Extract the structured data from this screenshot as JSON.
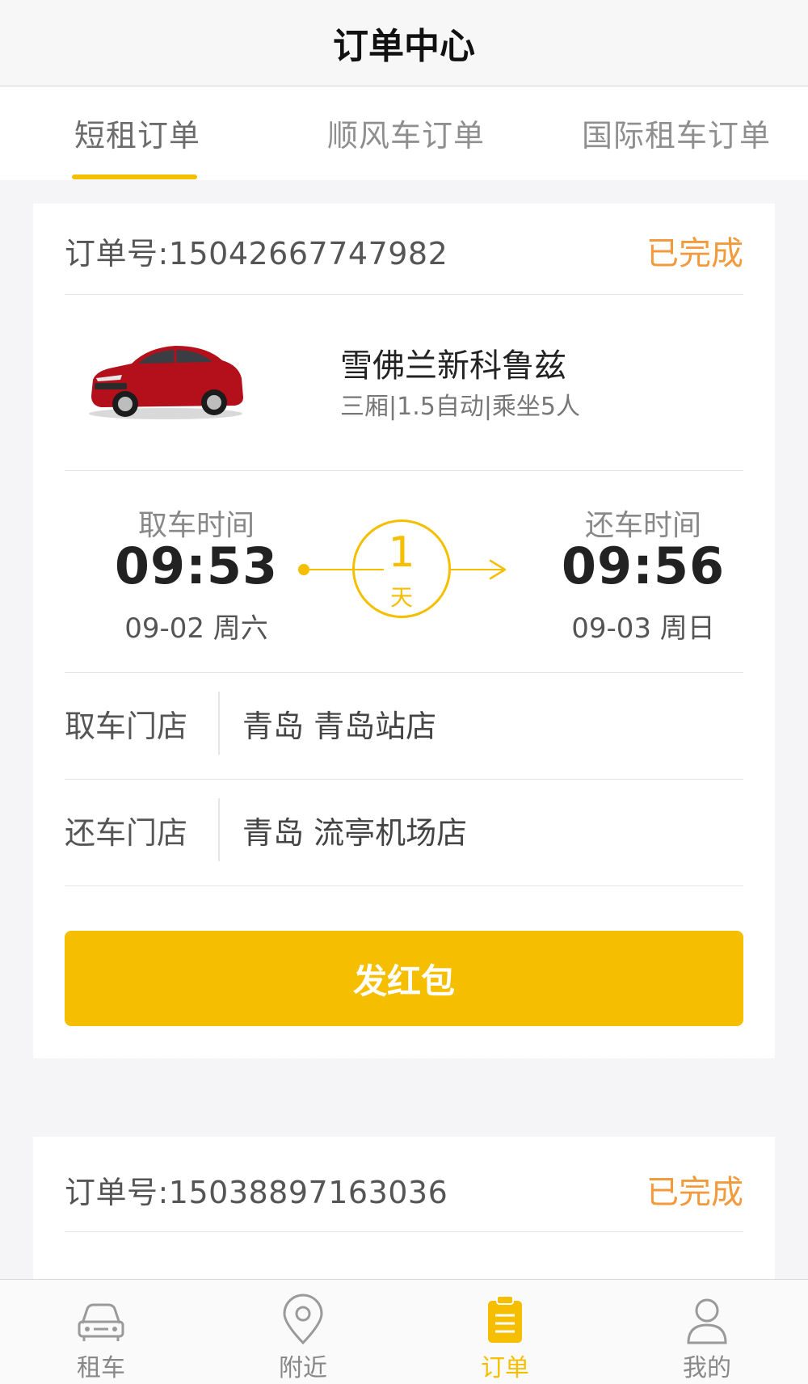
{
  "header": {
    "title": "订单中心"
  },
  "tabs": [
    {
      "label": "短租订单",
      "active": true
    },
    {
      "label": "顺风车订单",
      "active": false
    },
    {
      "label": "国际租车订单",
      "active": false
    }
  ],
  "orders": [
    {
      "order_no": "订单号:15042667747982",
      "status": "已完成",
      "car": {
        "name": "雪佛兰新科鲁兹",
        "spec": "三厢|1.5自动|乘坐5人"
      },
      "pickup": {
        "label": "取车时间",
        "time": "09:53",
        "date": "09-02 周六"
      },
      "duration": {
        "num": "1",
        "unit": "天"
      },
      "return": {
        "label": "还车时间",
        "time": "09:56",
        "date": "09-03 周日"
      },
      "pickup_store": {
        "label": "取车门店",
        "value": "青岛 青岛站店"
      },
      "return_store": {
        "label": "还车门店",
        "value": "青岛 流亭机场店"
      },
      "button_label": "发红包"
    },
    {
      "order_no": "订单号:15038897163036",
      "status": "已完成"
    }
  ],
  "bottom_nav": [
    {
      "label": "租车",
      "icon": "car-icon",
      "active": false
    },
    {
      "label": "附近",
      "icon": "location-pin-icon",
      "active": false
    },
    {
      "label": "订单",
      "icon": "clipboard-icon",
      "active": true
    },
    {
      "label": "我的",
      "icon": "person-icon",
      "active": false
    }
  ],
  "colors": {
    "accent": "#f5bf00",
    "status": "#f39a3c",
    "background": "#f5f5f7"
  }
}
